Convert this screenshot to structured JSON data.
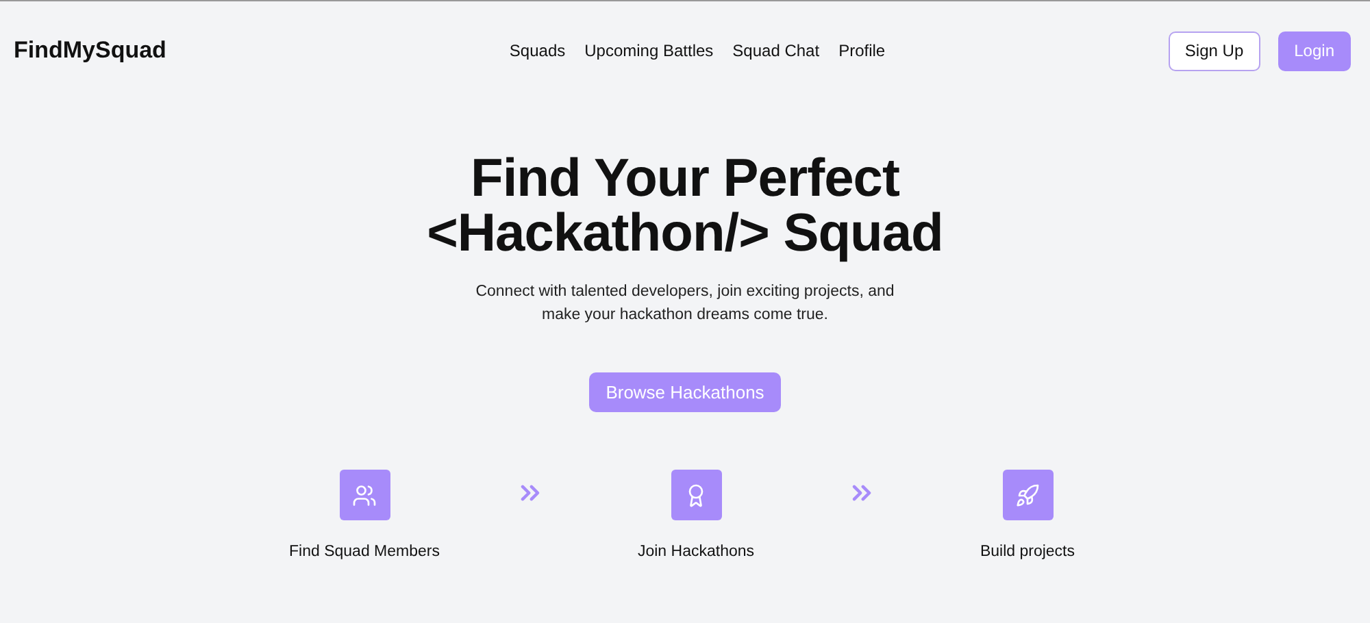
{
  "brand": "FindMySquad",
  "nav": [
    {
      "label": "Squads"
    },
    {
      "label": "Upcoming Battles"
    },
    {
      "label": "Squad Chat"
    },
    {
      "label": "Profile"
    }
  ],
  "actions": [
    {
      "label": "Sign Up",
      "kind": "outline"
    },
    {
      "label": "Login",
      "kind": "solid"
    }
  ],
  "hero": {
    "title_line_1": "Find Your Perfect",
    "title_line_2": "<Hackathon/> Squad",
    "subtitle": "Connect with talented developers, join exciting projects, and make your hackathon dreams come true.",
    "button": "Browse Hackathons"
  },
  "steps": [
    {
      "label": "Find Squad Members",
      "kind": "users"
    },
    {
      "label": "Join Hackathons",
      "kind": "award"
    },
    {
      "label": "Build projects",
      "kind": "rocket"
    }
  ]
}
